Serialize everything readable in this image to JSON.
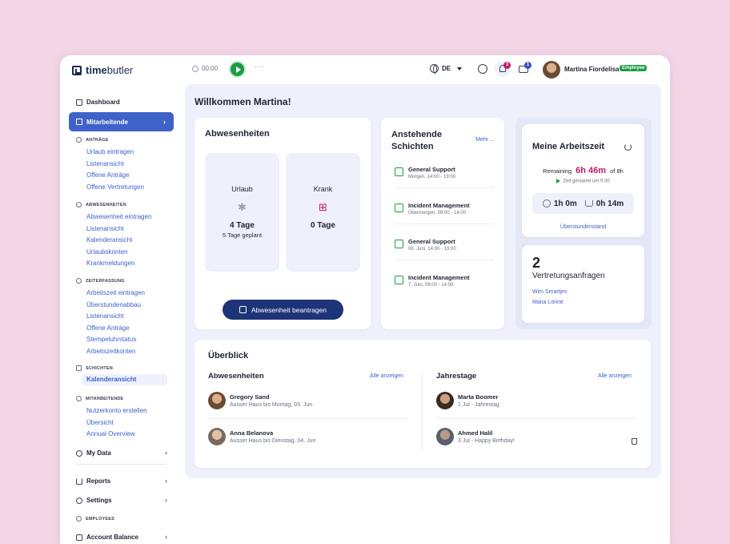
{
  "topbar": {
    "logo_bold": "time",
    "logo_rest": "butler",
    "timer": "00:00",
    "dots": "···",
    "language": "DE",
    "notification_count": "3",
    "message_count": "1",
    "user_name": "Martina Fiordelisa",
    "user_role": "Employee"
  },
  "sidebar": {
    "dashboard": "Dashboard",
    "mitarbeitende_active": "Mitarbeitende",
    "antraege": {
      "title": "ANTRÄGE",
      "items": [
        "Urlaub eintragen",
        "Listenansicht",
        "Offene Anträge",
        "Offene Vertretungen"
      ]
    },
    "abwesenheiten": {
      "title": "ABWESENHEITEN",
      "items": [
        "Abwesenheit eintragen",
        "Listenansicht",
        "Kalenderansicht",
        "Urlaubskonten",
        "Krankmeldungen"
      ]
    },
    "zeiterfassung": {
      "title": "ZEITERFASSUNG",
      "items": [
        "Arbeitszeit eintragen",
        "Überstundenabbau",
        "Listenansicht",
        "Offene Anträge",
        "Stempeluhrstatus",
        "Arbeitszeitkonten"
      ]
    },
    "schichten": {
      "title": "SCHICHTEN",
      "items": [
        "Kalenderansicht"
      ]
    },
    "mitarbeitende": {
      "title": "MITARBEITENDE",
      "items": [
        "Nutzerkonto erstellen",
        "Übersicht",
        "Annual Overview"
      ]
    },
    "my_data": "My Data",
    "reports": "Reports",
    "settings": "Settings",
    "employees": "EMPLOYEES",
    "account_balance": "Account Balance"
  },
  "main": {
    "welcome": "Willkommen Martina!",
    "absences": {
      "title": "Abwesenheiten",
      "urlaub": {
        "label": "Urlaub",
        "value": "4 Tage",
        "sub": "5 Tage geplant"
      },
      "krank": {
        "label": "Krank",
        "value": "0 Tage"
      },
      "button": "Abwesenheit beantragen"
    },
    "shifts": {
      "title_1": "Anstehende",
      "title_2": "Schichten",
      "more": "Mehr ...",
      "items": [
        {
          "name": "General Support",
          "time": "Morgen, 14:00 - 19:00"
        },
        {
          "name": "Incident Management",
          "time": "Übermorgen, 09:00 - 14:00"
        },
        {
          "name": "General Support",
          "time": "06. Juni, 14:00 - 19:00"
        },
        {
          "name": "Incident Management",
          "time": "7. Juni, 09:00 - 14:00"
        }
      ]
    },
    "worktime": {
      "title": "Meine Arbeitszeit",
      "remaining_label": "Remaining",
      "remaining_value": "6h 46m",
      "of": "of 8h",
      "started": "Zeit gestartet um 9:30",
      "worked": "1h 0m",
      "break": "0h 14m",
      "overtime_link": "Überstundenstand"
    },
    "substitution": {
      "count": "2",
      "label": "Vertretungsanfragen",
      "names": [
        "Wim Smartjes",
        "Maria Lönne"
      ]
    },
    "overview": {
      "title": "Überblick",
      "absences_title": "Abwesenheiten",
      "absences_link": "Alle anzeigen",
      "absences": [
        {
          "name": "Gregory Sand",
          "detail": "Ausser Haus bis Montag, 03. Jun"
        },
        {
          "name": "Anna Belanova",
          "detail": "Ausser Haus bis Dienstag, 04. Jun"
        }
      ],
      "anniversaries_title": "Jahrestage",
      "anniversaries_link": "Alle anzeigen",
      "anniversaries": [
        {
          "name": "Marta Boomer",
          "detail": "1 Jul - Jahrestag"
        },
        {
          "name": "Ahmed Halil",
          "detail": "3 Jul - Happy Birthday!"
        }
      ]
    }
  },
  "colors": {
    "accent": "#3f62c9",
    "primary_dark": "#1d3478",
    "success": "#1d9b45",
    "highlight": "#c2186b",
    "background": "#f2d6e6"
  }
}
